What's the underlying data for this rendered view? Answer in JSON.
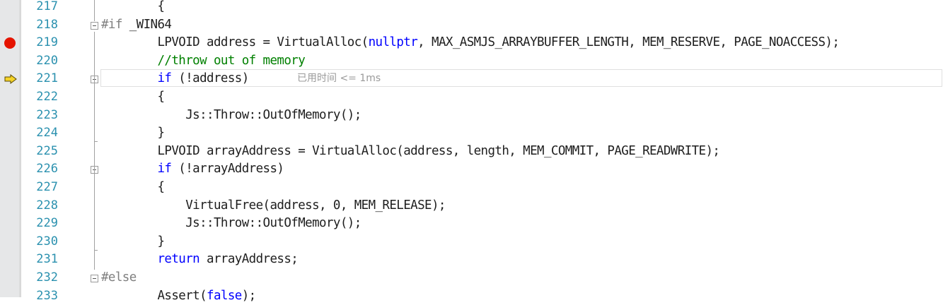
{
  "editor": {
    "lines": [
      {
        "num": "217",
        "tokens": [
          {
            "t": "text",
            "v": "        {"
          }
        ]
      },
      {
        "num": "218",
        "tokens": [
          {
            "t": "pp",
            "v": "#if"
          },
          {
            "t": "text",
            "v": " _WIN64"
          }
        ]
      },
      {
        "num": "219",
        "tokens": [
          {
            "t": "text",
            "v": "        LPVOID address = VirtualAlloc("
          },
          {
            "t": "kw",
            "v": "nullptr"
          },
          {
            "t": "text",
            "v": ", MAX_ASMJS_ARRAYBUFFER_LENGTH, MEM_RESERVE, PAGE_NOACCESS);"
          }
        ]
      },
      {
        "num": "220",
        "tokens": [
          {
            "t": "cm",
            "v": "        //throw out of memory"
          }
        ]
      },
      {
        "num": "221",
        "tokens": [
          {
            "t": "text",
            "v": "        "
          },
          {
            "t": "kw",
            "v": "if"
          },
          {
            "t": "text",
            "v": " (!address)"
          }
        ]
      },
      {
        "num": "222",
        "tokens": [
          {
            "t": "text",
            "v": "        {"
          }
        ]
      },
      {
        "num": "223",
        "tokens": [
          {
            "t": "text",
            "v": "            Js::Throw::OutOfMemory();"
          }
        ]
      },
      {
        "num": "224",
        "tokens": [
          {
            "t": "text",
            "v": "        }"
          }
        ]
      },
      {
        "num": "225",
        "tokens": [
          {
            "t": "text",
            "v": "        LPVOID arrayAddress = VirtualAlloc(address, length, MEM_COMMIT, PAGE_READWRITE);"
          }
        ]
      },
      {
        "num": "226",
        "tokens": [
          {
            "t": "text",
            "v": "        "
          },
          {
            "t": "kw",
            "v": "if"
          },
          {
            "t": "text",
            "v": " (!arrayAddress)"
          }
        ]
      },
      {
        "num": "227",
        "tokens": [
          {
            "t": "text",
            "v": "        {"
          }
        ]
      },
      {
        "num": "228",
        "tokens": [
          {
            "t": "text",
            "v": "            VirtualFree(address, 0, MEM_RELEASE);"
          }
        ]
      },
      {
        "num": "229",
        "tokens": [
          {
            "t": "text",
            "v": "            Js::Throw::OutOfMemory();"
          }
        ]
      },
      {
        "num": "230",
        "tokens": [
          {
            "t": "text",
            "v": "        }"
          }
        ]
      },
      {
        "num": "231",
        "tokens": [
          {
            "t": "text",
            "v": "        "
          },
          {
            "t": "kw",
            "v": "return"
          },
          {
            "t": "text",
            "v": " arrayAddress;"
          }
        ]
      },
      {
        "num": "232",
        "tokens": [
          {
            "t": "pp",
            "v": "#else"
          }
        ]
      },
      {
        "num": "233",
        "tokens": [
          {
            "t": "text",
            "v": "        Assert("
          },
          {
            "t": "kw",
            "v": "false"
          },
          {
            "t": "text",
            "v": ");"
          }
        ]
      }
    ],
    "perf_tip": "已用时间 <= 1ms",
    "breakpoint_line": "219",
    "current_line": "221",
    "fold_lines": [
      "218",
      "221",
      "226",
      "232"
    ],
    "colors": {
      "keyword": "#0000ff",
      "comment": "#008000",
      "preprocessor": "#808080",
      "line_number": "#2b91af",
      "breakpoint": "#e51400",
      "instruction_pointer": "#f5d328"
    }
  }
}
